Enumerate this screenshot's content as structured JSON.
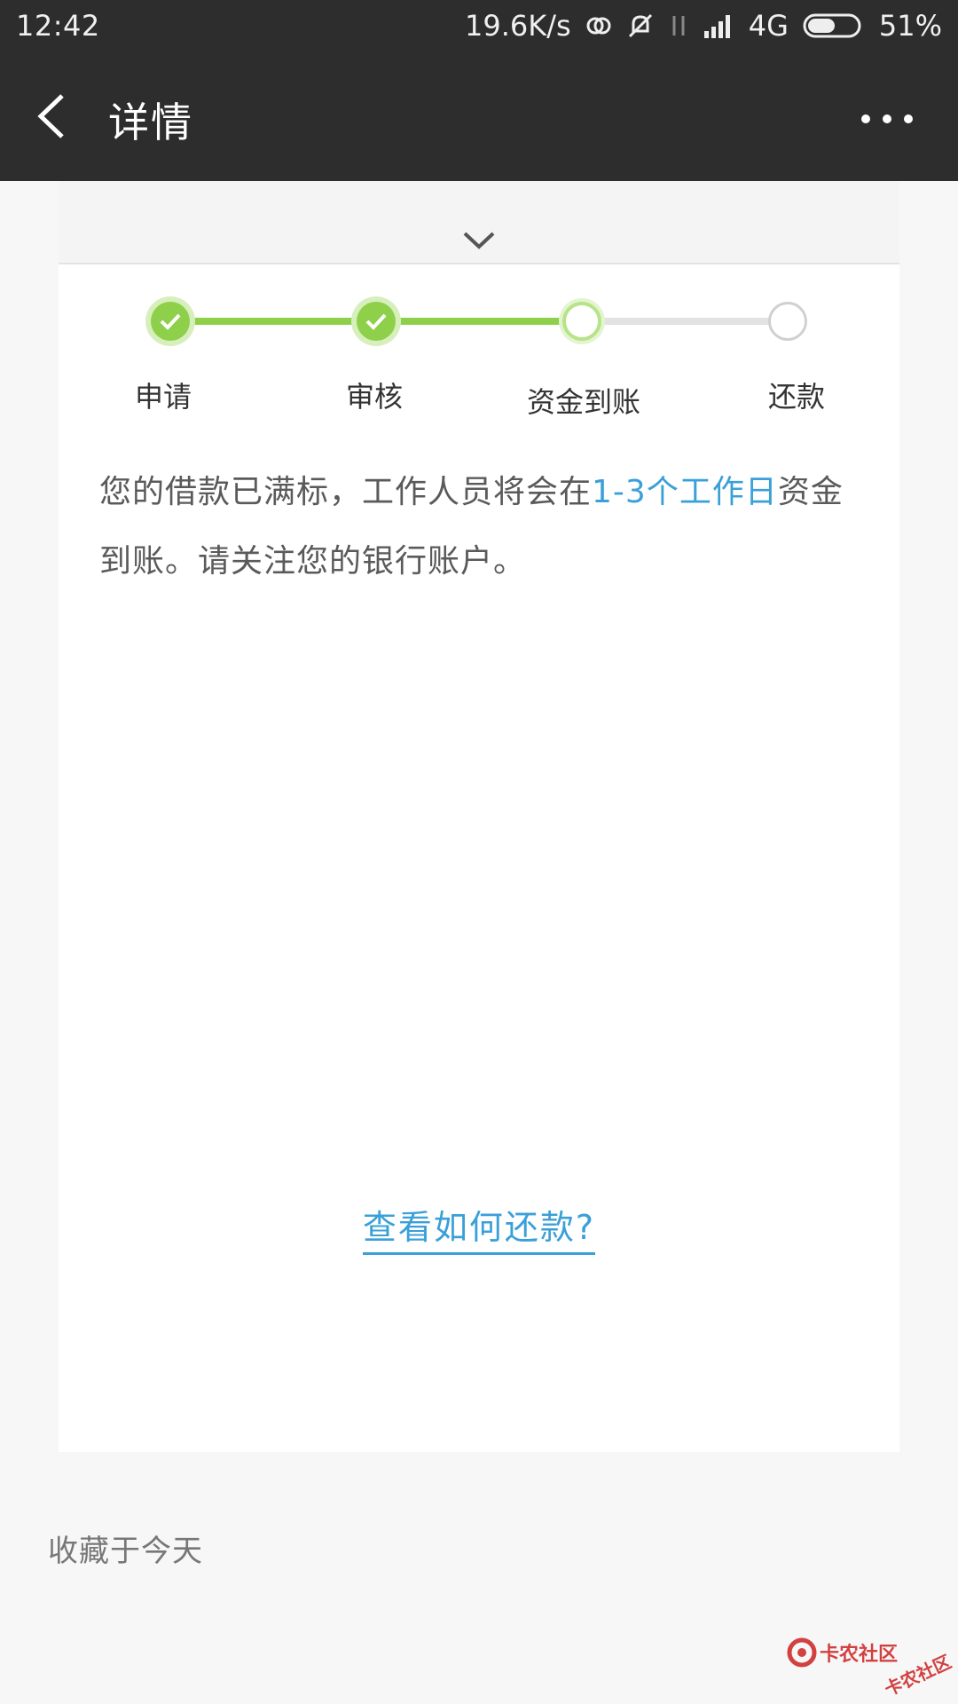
{
  "status_bar": {
    "time": "12:42",
    "speed": "19.6K/s",
    "network": "4G",
    "battery": "51%"
  },
  "app_bar": {
    "title": "详情"
  },
  "stepper": {
    "steps": [
      {
        "label": "申请",
        "state": "done"
      },
      {
        "label": "审核",
        "state": "done"
      },
      {
        "label": "资金到账",
        "state": "current"
      },
      {
        "label": "还款",
        "state": "todo"
      }
    ],
    "accent_color": "#8fd04a"
  },
  "message": {
    "part1": "您的借款已满标，工作人员将会在",
    "highlight": "1-3个工作日",
    "part2": "资金到账。请关注您的银行账户。"
  },
  "repay_link": {
    "label": "查看如何还款?"
  },
  "footer": {
    "saved": "收藏于今天"
  },
  "watermark": {
    "text": "卡农社区"
  },
  "colors": {
    "bar": "#2d2d2d",
    "link": "#3aa0d8"
  }
}
